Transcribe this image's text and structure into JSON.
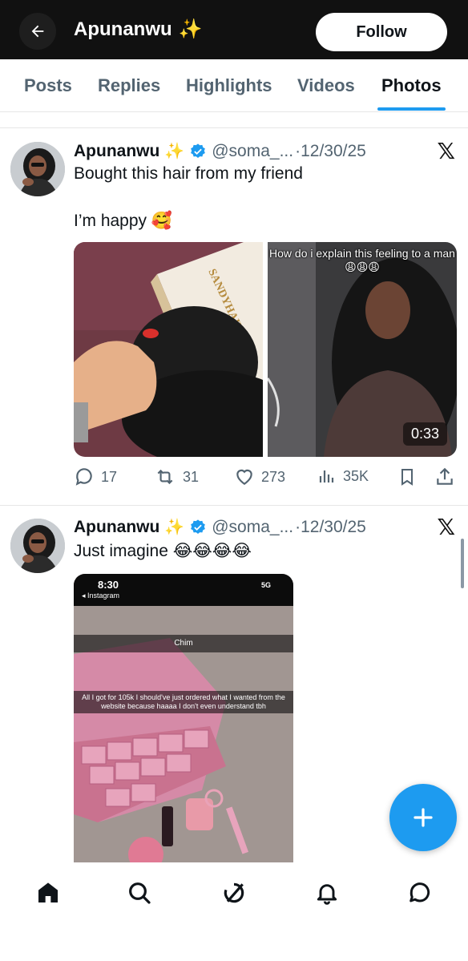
{
  "header": {
    "title": "Apunanwu",
    "title_emoji": "✨",
    "follow_label": "Follow"
  },
  "tabs": [
    {
      "label": "Posts",
      "active": false
    },
    {
      "label": "Replies",
      "active": false
    },
    {
      "label": "Highlights",
      "active": false
    },
    {
      "label": "Videos",
      "active": false
    },
    {
      "label": "Photos",
      "active": true
    }
  ],
  "tweets": [
    {
      "name": "Apunanwu",
      "name_emoji": "✨",
      "handle": "@soma_...",
      "date": "·12/30/25",
      "text_line1": "Bought this hair from my friend",
      "text_line2": "I’m happy 🥰",
      "box_text": "SANDYHAIRS",
      "video_caption": "How do i explain this feeling to a man😩😩😩",
      "video_duration": "0:33",
      "replies": "17",
      "reposts": "31",
      "likes": "273",
      "views": "35K"
    },
    {
      "name": "Apunanwu",
      "name_emoji": "✨",
      "handle": "@soma_...",
      "date": "·12/30/25",
      "text_line1": "Just imagine 😂😂😂😂",
      "phone_time": "8:30",
      "phone_back": "◂ Instagram",
      "phone_signal": "5G",
      "snap_name": "Chim",
      "snap_caption": "All I got for 105k I should've just ordered what I wanted from the website because haaaa I don't even understand tbh"
    }
  ],
  "colors": {
    "accent": "#1d9bf0",
    "header_bg": "#111111",
    "verified": "#1d9bf0",
    "muted_text": "#536471"
  },
  "icons": [
    "back-arrow-icon",
    "sparkle-icon",
    "verified-badge-icon",
    "x-logo-icon",
    "reply-icon",
    "repost-icon",
    "like-icon",
    "views-icon",
    "bookmark-icon",
    "share-icon",
    "compose-plus-icon",
    "home-icon",
    "search-icon",
    "grok-icon",
    "notifications-icon",
    "messages-icon"
  ]
}
